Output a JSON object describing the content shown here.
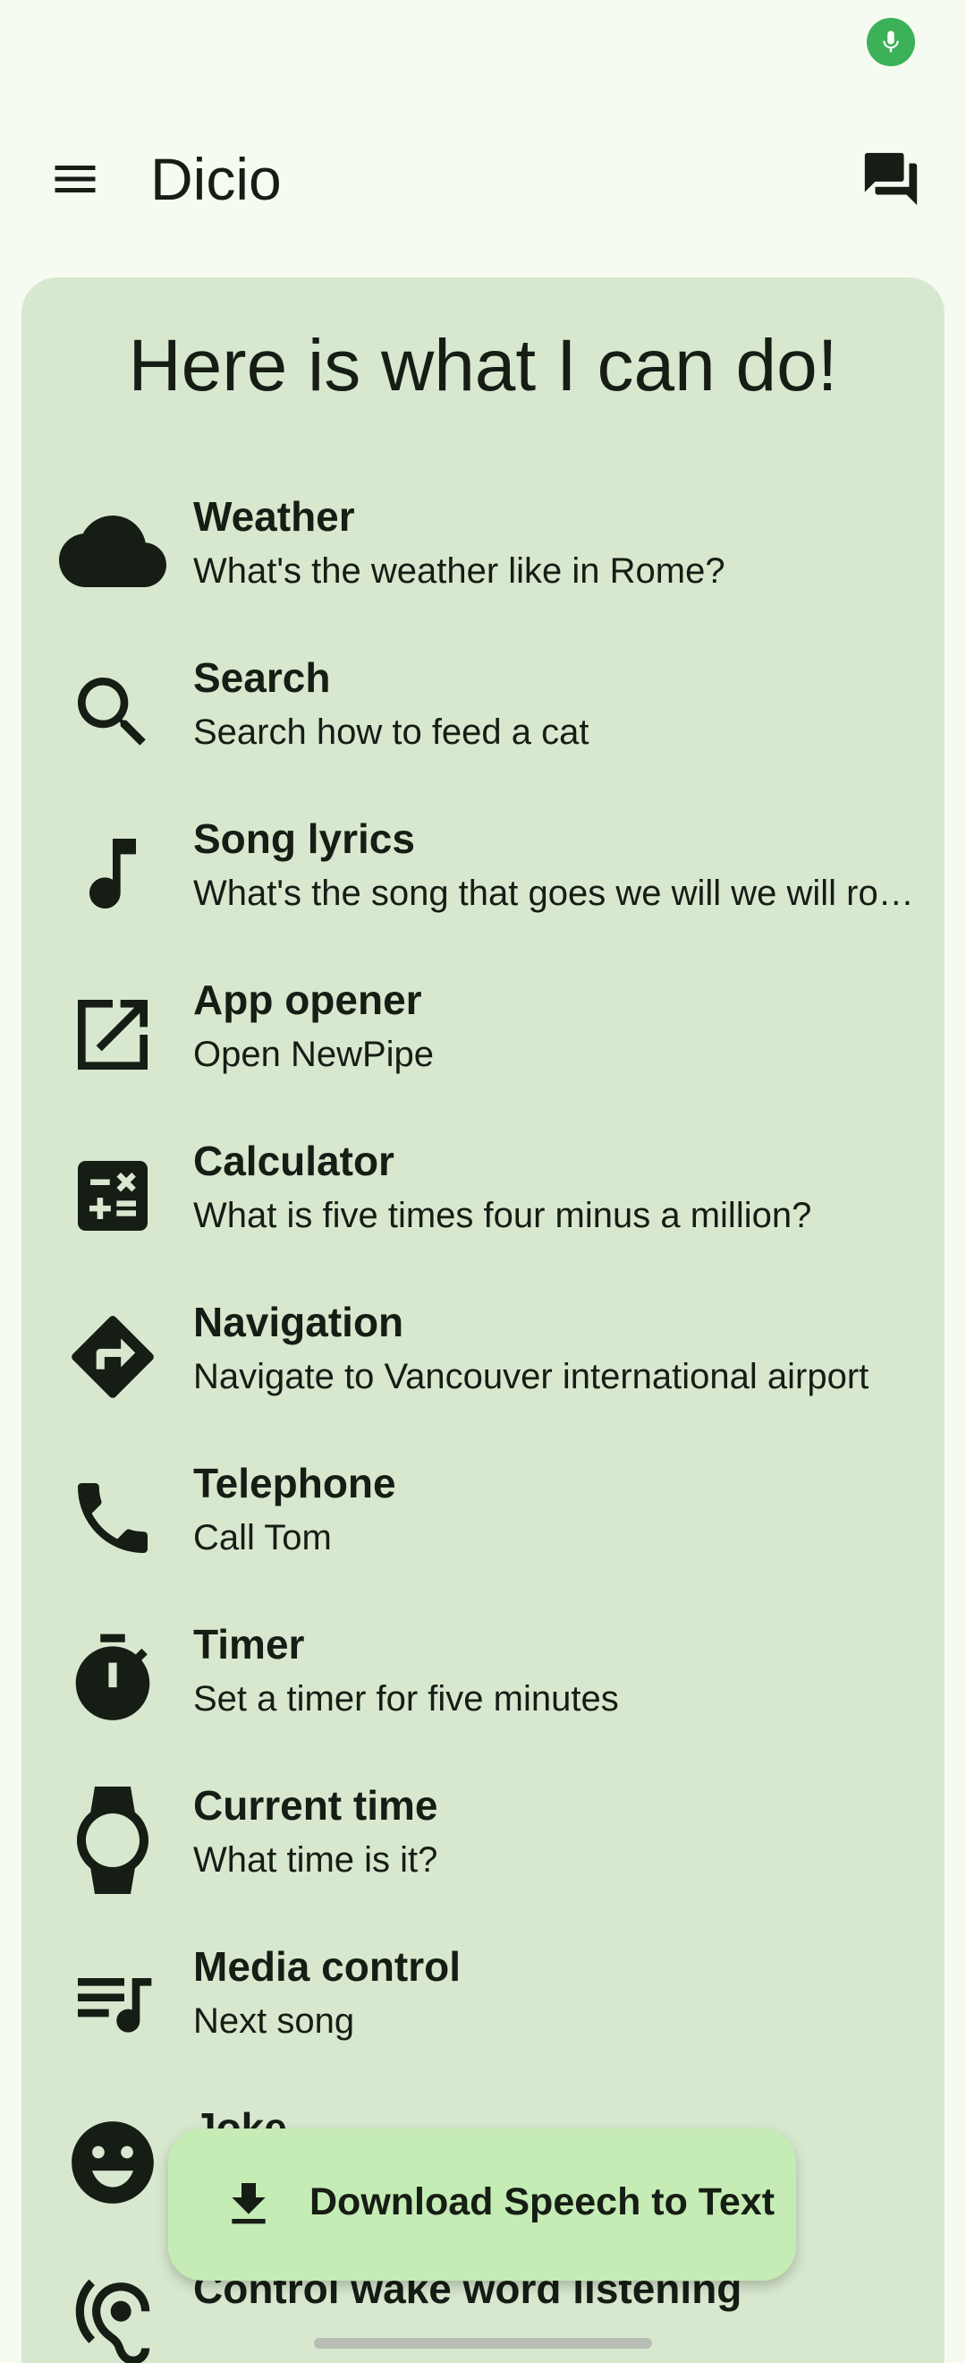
{
  "app": {
    "title": "Dicio"
  },
  "card": {
    "title": "Here is what I can do!"
  },
  "skills": [
    {
      "name": "Weather",
      "example": "What's the weather like in Rome?",
      "icon": "cloud-icon"
    },
    {
      "name": "Search",
      "example": "Search how to feed a cat",
      "icon": "search-icon"
    },
    {
      "name": "Song lyrics",
      "example": "What's the song that goes we will we will rock you?",
      "icon": "music-note-icon"
    },
    {
      "name": "App opener",
      "example": "Open NewPipe",
      "icon": "open-in-new-icon"
    },
    {
      "name": "Calculator",
      "example": "What is five times four minus a million?",
      "icon": "calculate-icon"
    },
    {
      "name": "Navigation",
      "example": "Navigate to Vancouver international airport",
      "icon": "directions-icon"
    },
    {
      "name": "Telephone",
      "example": "Call Tom",
      "icon": "phone-icon"
    },
    {
      "name": "Timer",
      "example": "Set a timer for five minutes",
      "icon": "timer-icon"
    },
    {
      "name": "Current time",
      "example": "What time is it?",
      "icon": "watch-icon"
    },
    {
      "name": "Media control",
      "example": "Next song",
      "icon": "queue-music-icon"
    },
    {
      "name": "Joke",
      "example": "",
      "icon": "smiley-icon"
    },
    {
      "name": "Control wake word listening",
      "example": "",
      "icon": "hearing-icon"
    }
  ],
  "fab": {
    "label": "Download Speech to Text",
    "icon": "download-icon"
  },
  "colors": {
    "background": "#f6fbf1",
    "card": "#d8e8cf",
    "fab": "#c4ecb4",
    "mic_indicator": "#3cb158",
    "text": "#161d15"
  }
}
